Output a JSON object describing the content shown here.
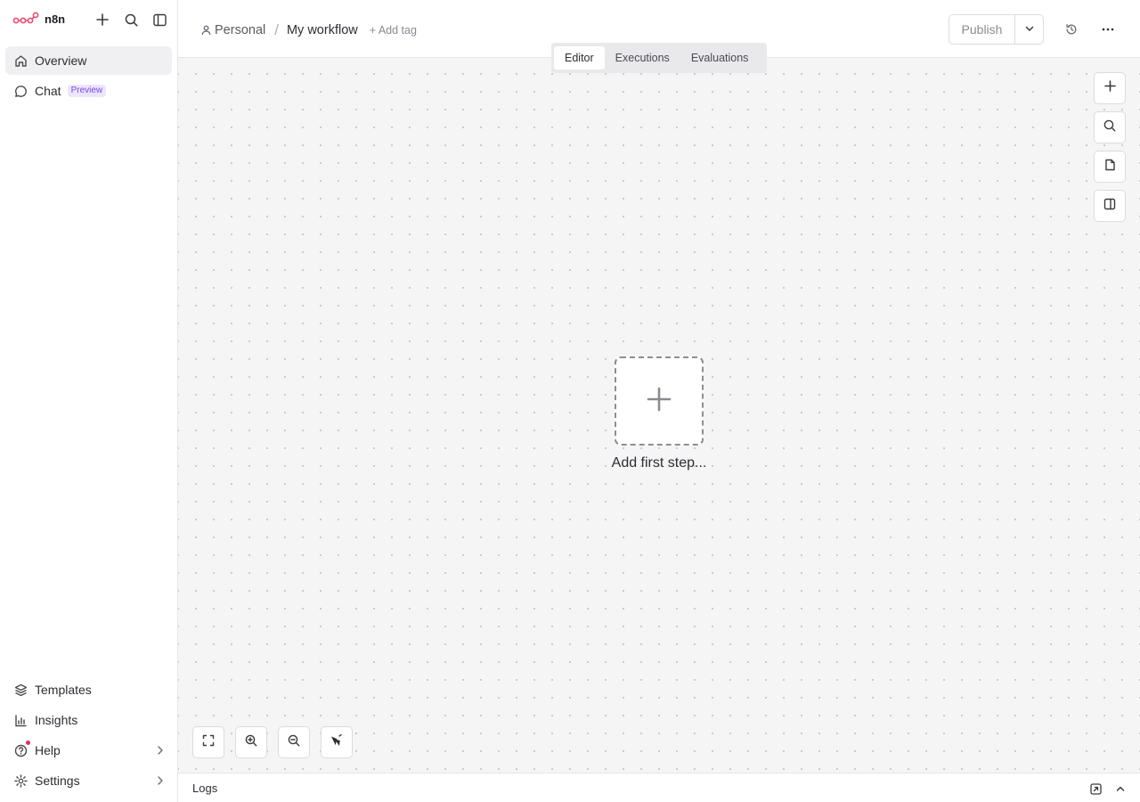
{
  "app": {
    "logo_text": "n8n",
    "brand_color": "#ea4b71"
  },
  "sidebar": {
    "top_items": [
      {
        "label": "Overview",
        "icon": "home-icon",
        "active": true
      },
      {
        "label": "Chat",
        "icon": "chat-icon",
        "badge": "Preview"
      }
    ],
    "bottom_items": [
      {
        "label": "Templates",
        "icon": "templates-icon"
      },
      {
        "label": "Insights",
        "icon": "insights-icon"
      },
      {
        "label": "Help",
        "icon": "help-icon",
        "notification_dot": true
      },
      {
        "label": "Settings",
        "icon": "gear-icon"
      }
    ]
  },
  "header": {
    "project": "Personal",
    "separator": "/",
    "workflow_name": "My workflow",
    "add_tag": "+ Add tag",
    "publish_label": "Publish"
  },
  "tabs": [
    {
      "label": "Editor",
      "active": true
    },
    {
      "label": "Executions"
    },
    {
      "label": "Evaluations"
    }
  ],
  "canvas": {
    "add_first_step_label": "Add first step..."
  },
  "logs": {
    "label": "Logs"
  }
}
